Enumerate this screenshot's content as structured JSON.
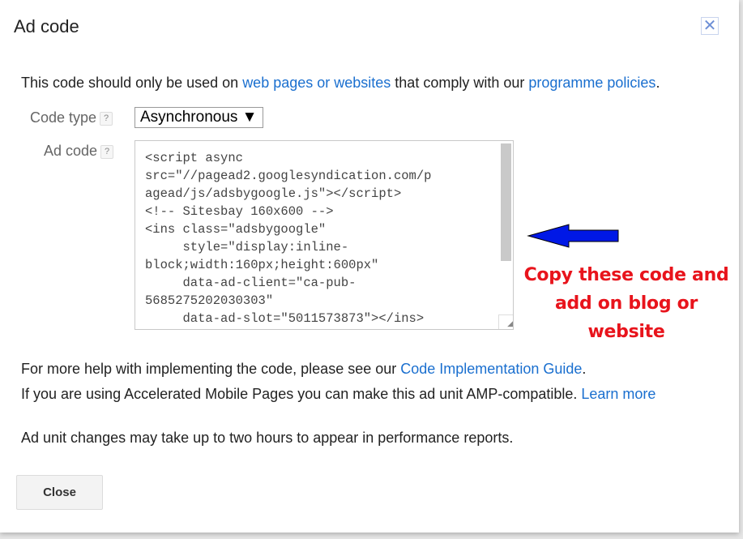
{
  "dialog": {
    "title": "Ad code",
    "close_icon": "close-x-icon"
  },
  "intro": {
    "prefix": "This code should only be used on ",
    "link1": "web pages or websites",
    "middle": " that comply with our ",
    "link2": "programme policies",
    "suffix": "."
  },
  "code_type": {
    "label": "Code type",
    "help": "?",
    "value": "Asynchronous ▼"
  },
  "ad_code": {
    "label": "Ad code",
    "help": "?",
    "value": "<script async\nsrc=\"//pagead2.googlesyndication.com/p\nagead/js/adsbygoogle.js\"></script>\n<!-- Sitesbay 160x600 -->\n<ins class=\"adsbygoogle\"\n     style=\"display:inline-\nblock;width:160px;height:600px\"\n     data-ad-client=\"ca-pub-\n5685275202030303\"\n     data-ad-slot=\"5011573873\"></ins>"
  },
  "annotation": {
    "line1": "Copy these code and",
    "line2": "add on blog or website",
    "arrow_color": "#0018e6",
    "text_color": "#e8141c"
  },
  "help": {
    "prefix": "For more help with implementing the code, please see our ",
    "link": "Code Implementation Guide",
    "suffix": "."
  },
  "amp": {
    "text": "If you are using Accelerated Mobile Pages you can make this ad unit AMP-compatible. ",
    "link": "Learn more"
  },
  "note": "Ad unit changes may take up to two hours to appear in performance reports.",
  "footer": {
    "close_label": "Close"
  }
}
